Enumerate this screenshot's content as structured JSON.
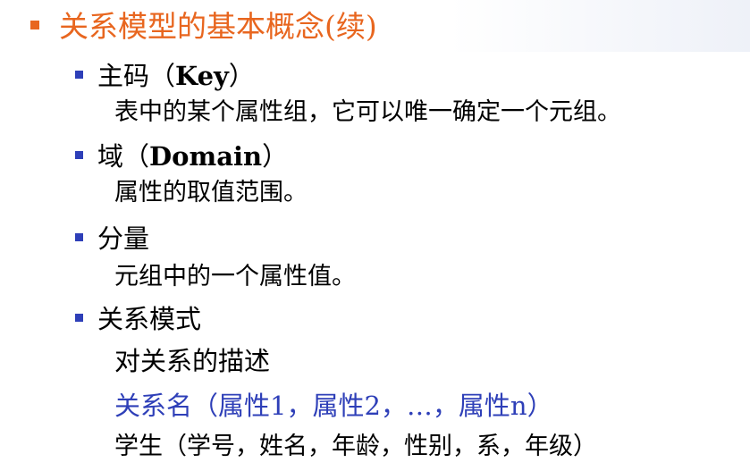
{
  "title": "关系模型的基本概念(续)",
  "colors": {
    "title": "#e8661f",
    "bullet": "#2e3fb8",
    "highlight": "#2e3fb8"
  },
  "items": [
    {
      "label_cn": "主码（",
      "label_en": "Key",
      "label_end": "）",
      "desc": "表中的某个属性组，它可以唯一确定一个元组。"
    },
    {
      "label_cn": "域（",
      "label_en": "Domain",
      "label_end": "）",
      "desc": "属性的取值范围。"
    },
    {
      "label_cn": "分量",
      "desc": "元组中的一个属性值。"
    },
    {
      "label_cn": "关系模式",
      "desc": "对关系的描述",
      "schema": "关系名（属性1，属性2，…，属性n）",
      "example": "学生（学号，姓名，年龄，性别，系，年级）"
    }
  ]
}
